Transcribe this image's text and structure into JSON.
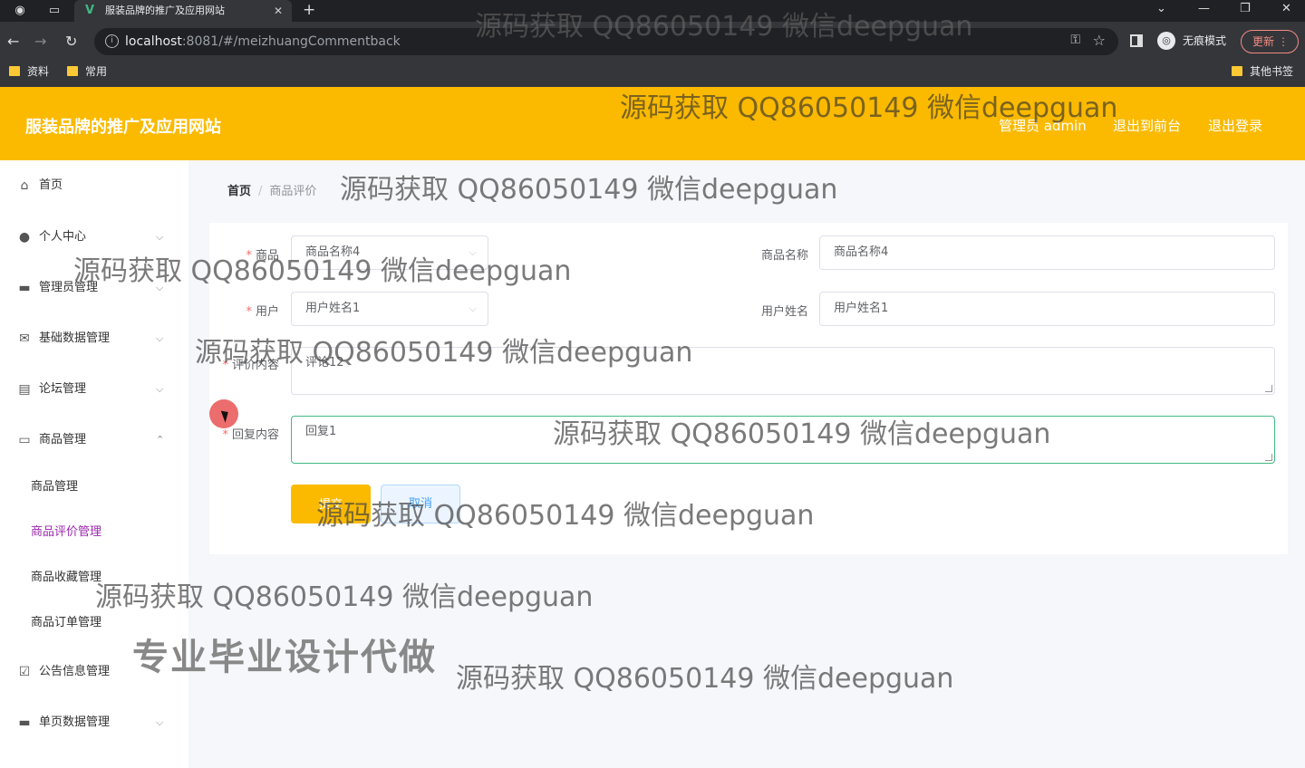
{
  "browser": {
    "tab_title": "服装品牌的推广及应用网站",
    "url_host": "localhost",
    "url_rest": ":8081/#/meizhuangCommentback",
    "incognito_label": "无痕模式",
    "update_label": "更新",
    "bookmarks": [
      "资料",
      "常用"
    ],
    "other_bookmarks": "其他书签"
  },
  "header": {
    "brand": "服装品牌的推广及应用网站",
    "user_label": "管理员 admin",
    "to_front": "退出到前台",
    "logout": "退出登录"
  },
  "sidebar": {
    "items": [
      {
        "label": "首页",
        "icon": "home-icon"
      },
      {
        "label": "个人中心",
        "icon": "user-icon"
      },
      {
        "label": "管理员管理",
        "icon": "briefcase-icon"
      },
      {
        "label": "基础数据管理",
        "icon": "mail-icon"
      },
      {
        "label": "论坛管理",
        "icon": "clipboard-icon"
      },
      {
        "label": "商品管理",
        "icon": "comment-icon"
      },
      {
        "label": "公告信息管理",
        "icon": "checklist-icon"
      },
      {
        "label": "单页数据管理",
        "icon": "monitor-icon"
      }
    ],
    "sub_items": [
      "商品管理",
      "商品评价管理",
      "商品收藏管理",
      "商品订单管理"
    ]
  },
  "breadcrumb": {
    "home": "首页",
    "current": "商品评价"
  },
  "form": {
    "product_label": "商品",
    "product_value": "商品名称4",
    "product_name_label": "商品名称",
    "product_name_value": "商品名称4",
    "user_label": "用户",
    "user_value": "用户姓名1",
    "user_name_label": "用户姓名",
    "user_name_value": "用户姓名1",
    "comment_label": "评价内容",
    "comment_value": "评论12",
    "reply_label": "回复内容",
    "reply_value": "回复1",
    "submit_label": "提交",
    "cancel_label": "取消"
  },
  "watermarks": {
    "text": "源码获取 QQ86050149 微信deepguan",
    "big": "专业毕业设计代做"
  }
}
